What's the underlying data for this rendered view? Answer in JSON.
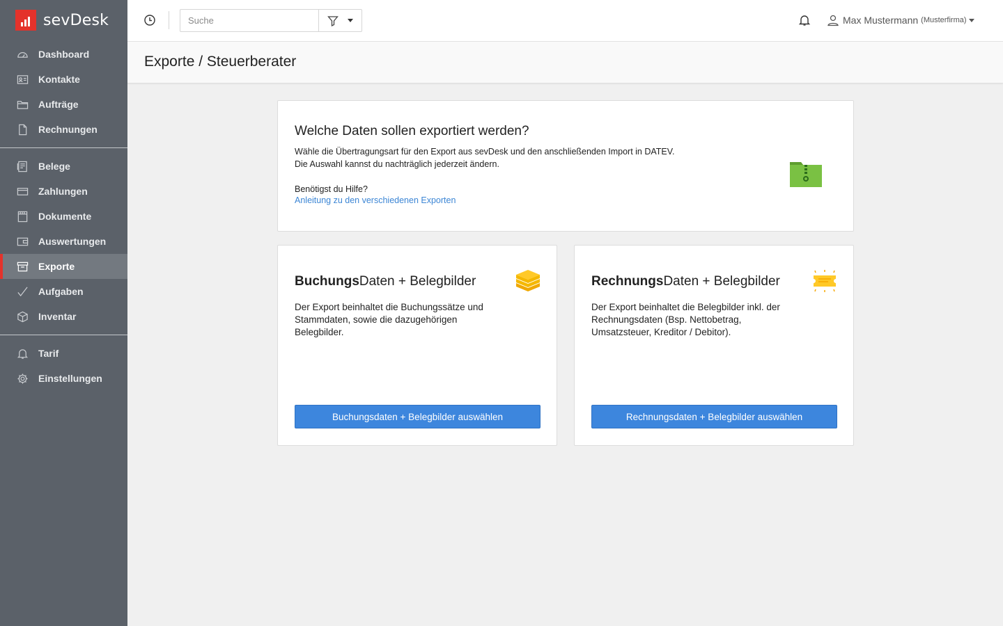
{
  "app": {
    "logo_text": "sevDesk",
    "brand_color": "#e4322b",
    "accent_color": "#3d86dd"
  },
  "sidebar": {
    "groups": [
      [
        {
          "label": "Dashboard",
          "icon": "gauge-icon"
        },
        {
          "label": "Kontakte",
          "icon": "contact-card-icon"
        },
        {
          "label": "Aufträge",
          "icon": "folder-icon"
        },
        {
          "label": "Rechnungen",
          "icon": "document-icon"
        }
      ],
      [
        {
          "label": "Belege",
          "icon": "receipt-icon"
        },
        {
          "label": "Zahlungen",
          "icon": "credit-card-icon"
        },
        {
          "label": "Dokumente",
          "icon": "film-document-icon"
        },
        {
          "label": "Auswertungen",
          "icon": "wallet-icon"
        },
        {
          "label": "Exporte",
          "icon": "archive-box-icon",
          "active": true
        },
        {
          "label": "Aufgaben",
          "icon": "checkmark-icon"
        },
        {
          "label": "Inventar",
          "icon": "cube-icon"
        }
      ],
      [
        {
          "label": "Tarif",
          "icon": "bell-icon"
        },
        {
          "label": "Einstellungen",
          "icon": "gear-icon"
        }
      ]
    ]
  },
  "topbar": {
    "search_placeholder": "Suche",
    "user_name": "Max Mustermann",
    "user_company": "(Musterfirma)"
  },
  "page": {
    "title": "Exporte / Steuerberater"
  },
  "intro": {
    "title": "Welche Daten sollen exportiert werden?",
    "line1": "Wähle die Übertragungsart für den Export aus sevDesk und den anschließenden Import in DATEV.",
    "line2": "Die Auswahl kannst du nachträglich jederzeit ändern.",
    "help_label": "Benötigst du Hilfe?",
    "help_link": "Anleitung zu den verschiedenen Exporten"
  },
  "options": [
    {
      "title_bold": "Buchungs",
      "title_rest": "Daten + Belegbilder",
      "description": "Der Export beinhaltet die Buchungssätze und Stammdaten, sowie die dazugehörigen Belegbilder.",
      "button": "Buchungsdaten + Belegbilder auswählen",
      "icon": "stack-icon"
    },
    {
      "title_bold": "Rechnungs",
      "title_rest": "Daten + Belegbilder",
      "description": "Der Export beinhaltet die Belegbilder inkl. der Rechnungsdaten (Bsp. Nettobetrag, Umsatzsteuer, Kreditor / Debitor).",
      "button": "Rechnungsdaten + Belegbilder auswählen",
      "icon": "ticket-icon"
    }
  ]
}
